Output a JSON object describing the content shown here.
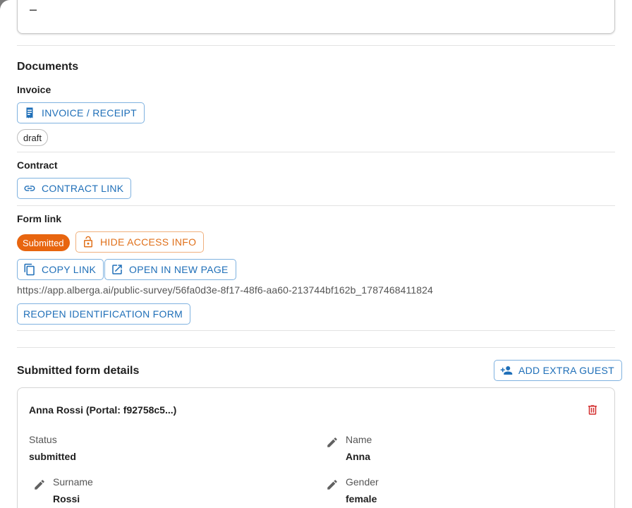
{
  "top_card": {
    "value": "–"
  },
  "documents": {
    "title": "Documents",
    "invoice": {
      "label": "Invoice",
      "button": "INVOICE / RECEIPT",
      "status": "draft"
    },
    "contract": {
      "label": "Contract",
      "button": "CONTRACT LINK"
    },
    "form_link": {
      "label": "Form link",
      "status": "Submitted",
      "hide_access_button": "HIDE ACCESS INFO",
      "copy_button": "COPY LINK",
      "open_button": "OPEN IN NEW PAGE",
      "url": "https://app.alberga.ai/public-survey/56fa0d3e-8f17-48f6-aa60-213744bf162b_1787468411824",
      "reopen_button": "REOPEN IDENTIFICATION FORM"
    }
  },
  "submitted": {
    "title": "Submitted form details",
    "add_guest_button": "ADD EXTRA GUEST",
    "guest": {
      "name": "Anna Rossi (Portal: f92758c5...)",
      "fields": [
        {
          "label": "Status",
          "value": "submitted"
        },
        {
          "label": "Name",
          "value": "Anna"
        },
        {
          "label": "Surname",
          "value": "Rossi"
        },
        {
          "label": "Gender",
          "value": "female"
        }
      ]
    }
  },
  "colors": {
    "accent": "#1f6fb8",
    "warning": "#e0701a",
    "submitted_chip": "#e8650f",
    "danger": "#d32f2f"
  }
}
